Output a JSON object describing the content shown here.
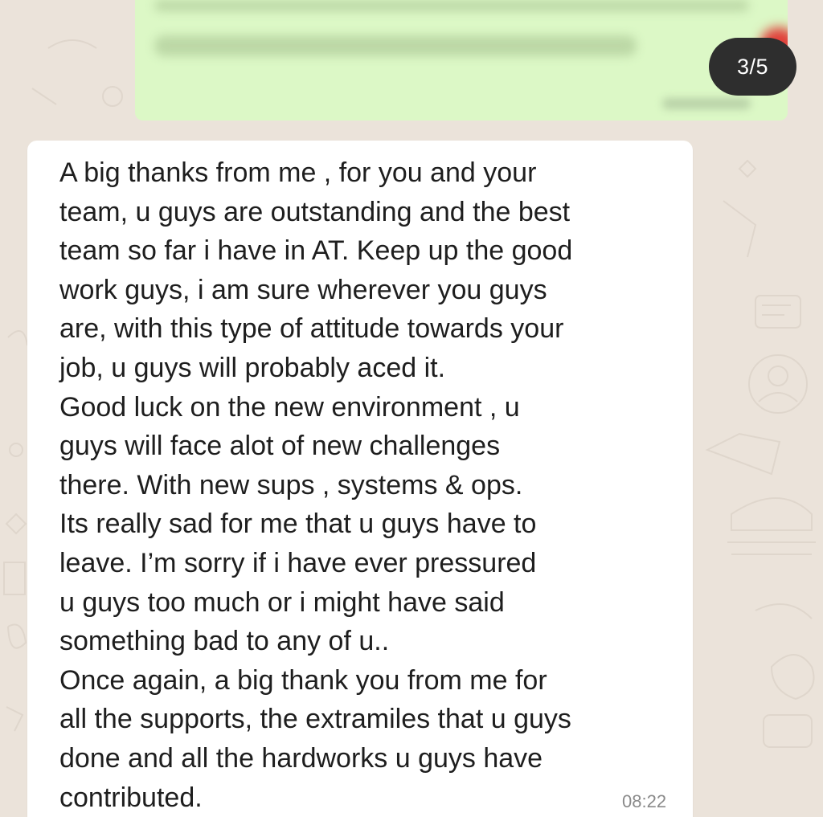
{
  "viewer": {
    "counter": "3/5"
  },
  "incoming_message": {
    "lines": [
      "A big thanks from me , for you and your",
      "team, u guys are outstanding and the best",
      "team so far i have in AT. Keep up the good",
      "work guys, i am sure wherever you guys",
      "are, with this type of attitude towards your",
      "job, u guys will probably aced it.",
      "Good luck on the new environment , u",
      "guys will face alot of new challenges",
      "there. With new sups , systems & ops.",
      "Its really sad for me that u guys have to",
      "leave. I’m sorry if i have ever pressured",
      "u guys too much or i might have said",
      "something bad to any of u..",
      "Once again, a big thank you from me for",
      "all the supports, the extramiles that u guys",
      "done and all the hardworks u guys have",
      "contributed."
    ],
    "time": "08:22"
  },
  "colors": {
    "chat_background": "#ebe3da",
    "sent_bubble": "#dcf8c6",
    "received_bubble": "#ffffff",
    "counter_badge": "#2e2e2e"
  },
  "icons": [
    "heart-emoji-icon"
  ]
}
